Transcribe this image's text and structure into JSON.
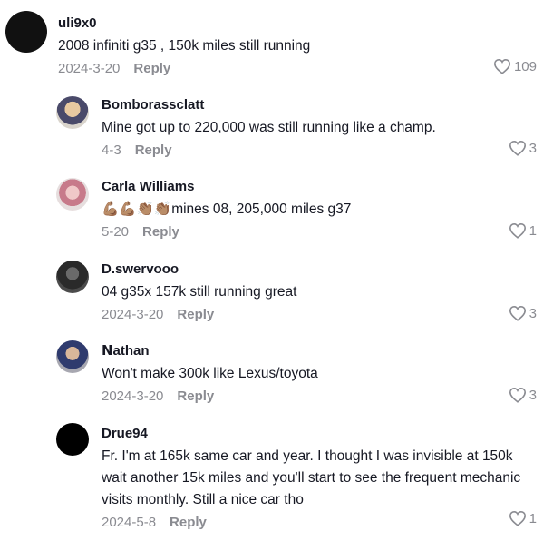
{
  "comments": [
    {
      "username": "uli9x0",
      "text": "2008 infiniti g35 , 150k miles still running",
      "date": "2024-3-20",
      "reply_label": "Reply",
      "likes": "109",
      "avatar_color": "#111111"
    },
    {
      "username": "Bomborassclatt",
      "text": "Mine got up to 220,000 was still running like a champ.",
      "date": "4-3",
      "reply_label": "Reply",
      "likes": "3"
    },
    {
      "username": "Carla Williams",
      "text": "💪🏽💪🏽👏🏽👏🏽mines 08, 205,000 miles g37",
      "date": "5-20",
      "reply_label": "Reply",
      "likes": "1"
    },
    {
      "username": "D.swervooo",
      "text": "04 g35x 157k still running great",
      "date": "2024-3-20",
      "reply_label": "Reply",
      "likes": "3"
    },
    {
      "username": "ꓠathan",
      "text": "Won't make 300k like Lexus/toyota",
      "date": "2024-3-20",
      "reply_label": "Reply",
      "likes": "3"
    },
    {
      "username": "Drue94",
      "text": "Fr. I'm at 165k same car and year. I thought I was invisible at 150k wait another 15k miles and you'll start to see the frequent mechanic visits monthly. Still a nice car tho",
      "date": "2024-5-8",
      "reply_label": "Reply",
      "likes": "1"
    }
  ]
}
